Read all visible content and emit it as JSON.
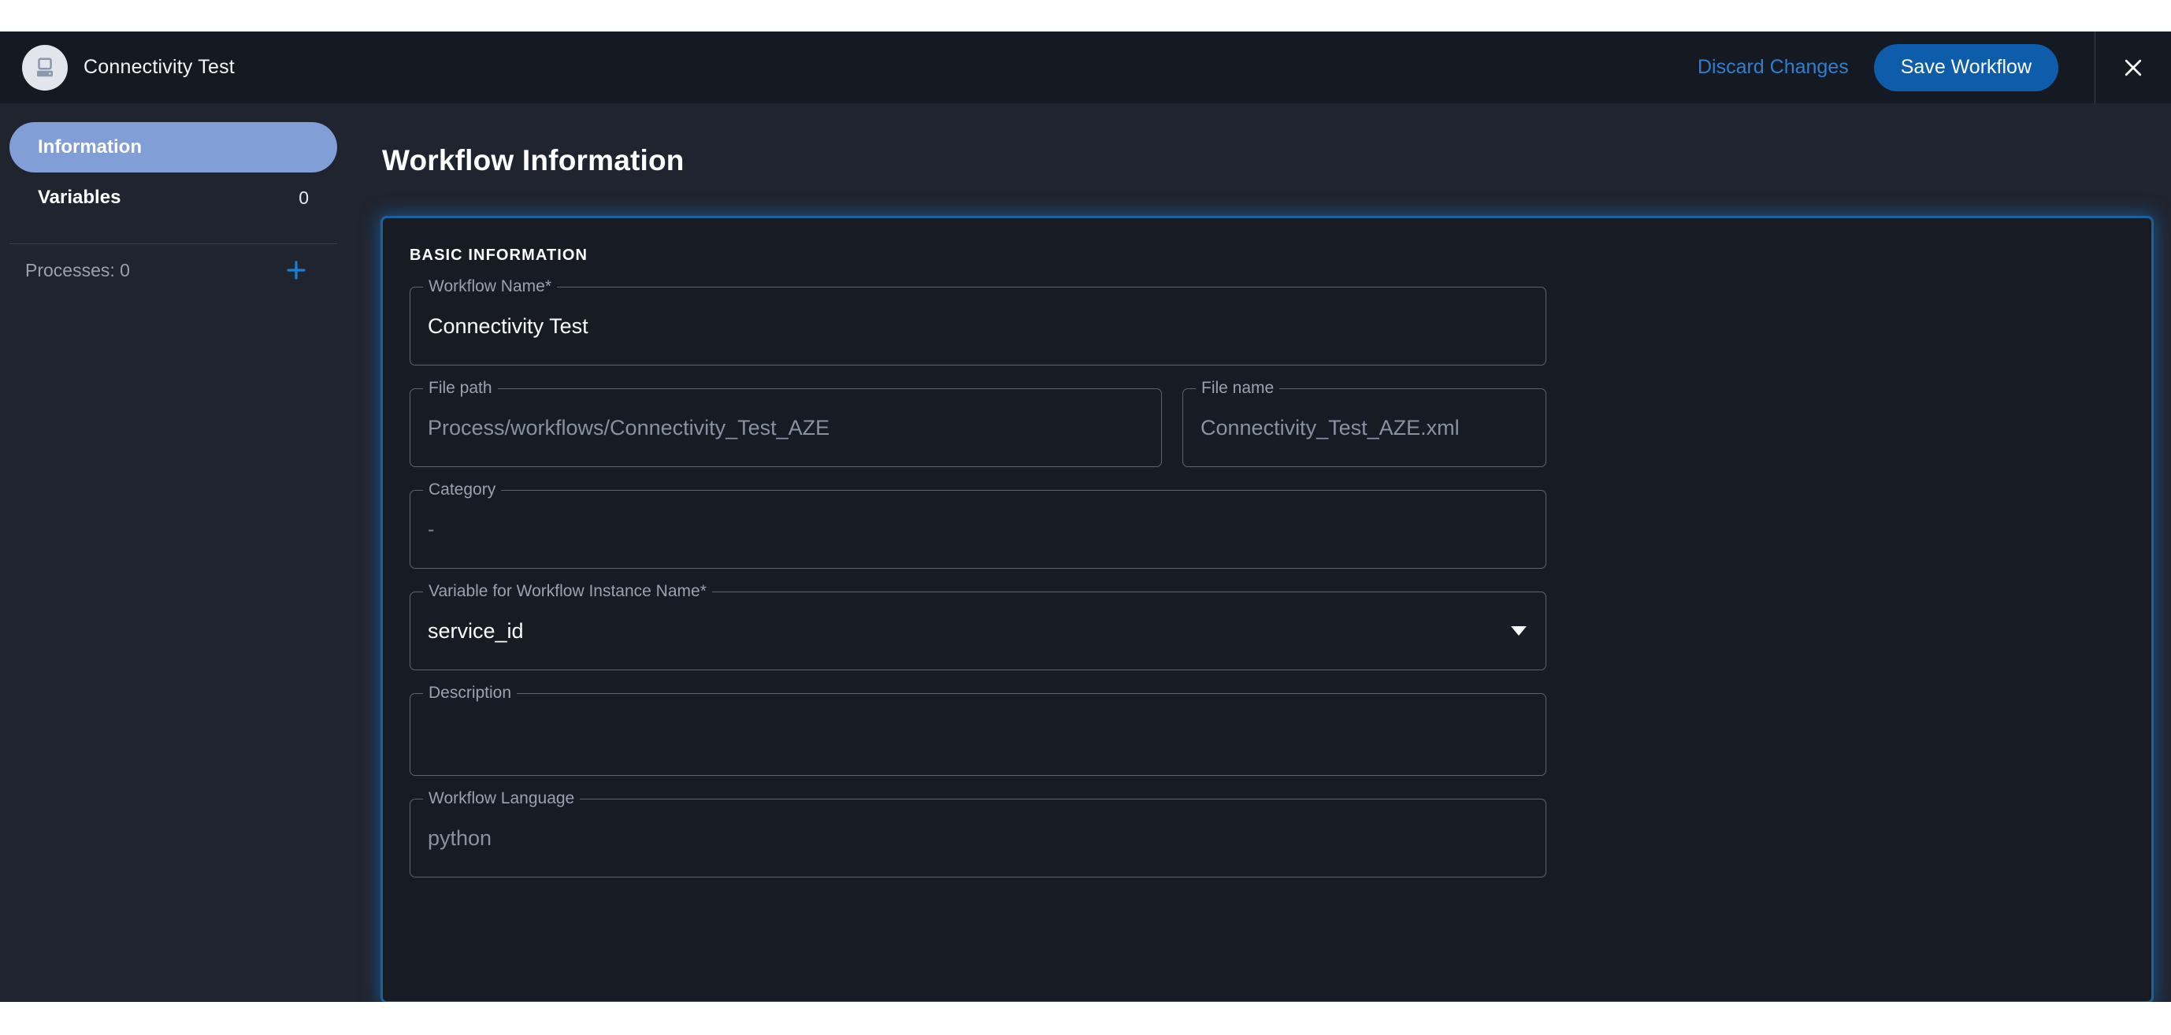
{
  "header": {
    "app_icon": "desktop-computer-icon",
    "title": "Connectivity Test",
    "discard_label": "Discard Changes",
    "save_label": "Save Workflow",
    "close_icon": "close-icon",
    "accent_blue": "#0d5dab",
    "link_blue": "#2f7fd0"
  },
  "sidebar": {
    "items": [
      {
        "label": "Information",
        "selected": true
      },
      {
        "label": "Variables",
        "count": "0",
        "selected": false
      }
    ],
    "processes": {
      "label": "Processes: 0",
      "add_icon": "plus-icon",
      "add_icon_color": "#1a7fd4"
    },
    "selected_pill_color": "#829ed6"
  },
  "main": {
    "page_title": "Workflow Information",
    "card": {
      "section_title": "BASIC INFORMATION",
      "border_color": "#1e5f9e",
      "fields": {
        "workflow_name": {
          "label": "Workflow Name",
          "required": "*",
          "value": "Connectivity Test",
          "disabled": false
        },
        "file_path": {
          "label": "File path",
          "value": "Process/workflows/Connectivity_Test_AZE",
          "disabled": true
        },
        "file_name": {
          "label": "File name",
          "value": "Connectivity_Test_AZE.xml",
          "disabled": true
        },
        "category": {
          "label": "Category",
          "value": "-",
          "disabled": true
        },
        "instance_name_variable": {
          "label": "Variable for Workflow Instance Name",
          "required": "*",
          "value": "service_id",
          "caret_icon": "chevron-down-icon",
          "disabled": false
        },
        "description": {
          "label": "Description",
          "value": "",
          "disabled": false
        },
        "workflow_language": {
          "label": "Workflow Language",
          "value": "python",
          "disabled": true
        }
      }
    }
  }
}
